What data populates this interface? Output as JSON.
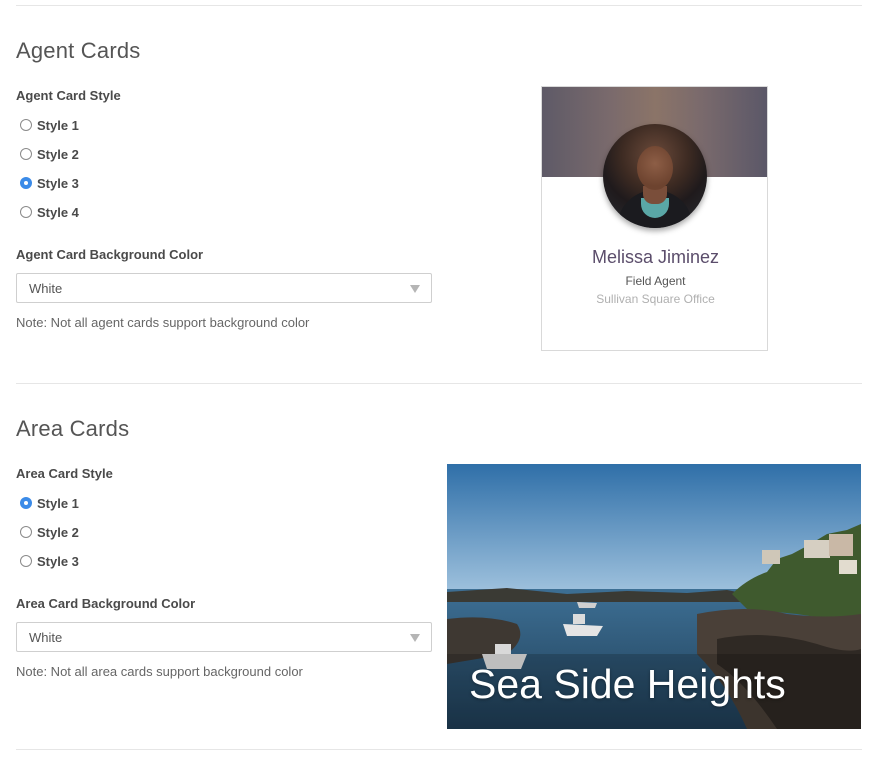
{
  "agent_section": {
    "title": "Agent Cards",
    "style_label": "Agent Card Style",
    "styles": [
      {
        "label": "Style 1",
        "checked": false
      },
      {
        "label": "Style 2",
        "checked": false
      },
      {
        "label": "Style 3",
        "checked": true
      },
      {
        "label": "Style 4",
        "checked": false
      }
    ],
    "bg_label": "Agent Card Background Color",
    "bg_value": "White",
    "note": "Note: Not all agent cards support background color",
    "preview": {
      "name": "Melissa Jiminez",
      "title": "Field Agent",
      "office": "Sullivan Square Office"
    }
  },
  "area_section": {
    "title": "Area Cards",
    "style_label": "Area Card Style",
    "styles": [
      {
        "label": "Style 1",
        "checked": true
      },
      {
        "label": "Style 2",
        "checked": false
      },
      {
        "label": "Style 3",
        "checked": false
      }
    ],
    "bg_label": "Area Card Background Color",
    "bg_value": "White",
    "note": "Note: Not all area cards support background color",
    "preview": {
      "name": "Sea Side Heights"
    }
  },
  "colors": {
    "accent": "#3b8be8",
    "agent_name": "#5b4d6b"
  },
  "icons": {
    "select_arrow": "chevron-down-icon"
  }
}
